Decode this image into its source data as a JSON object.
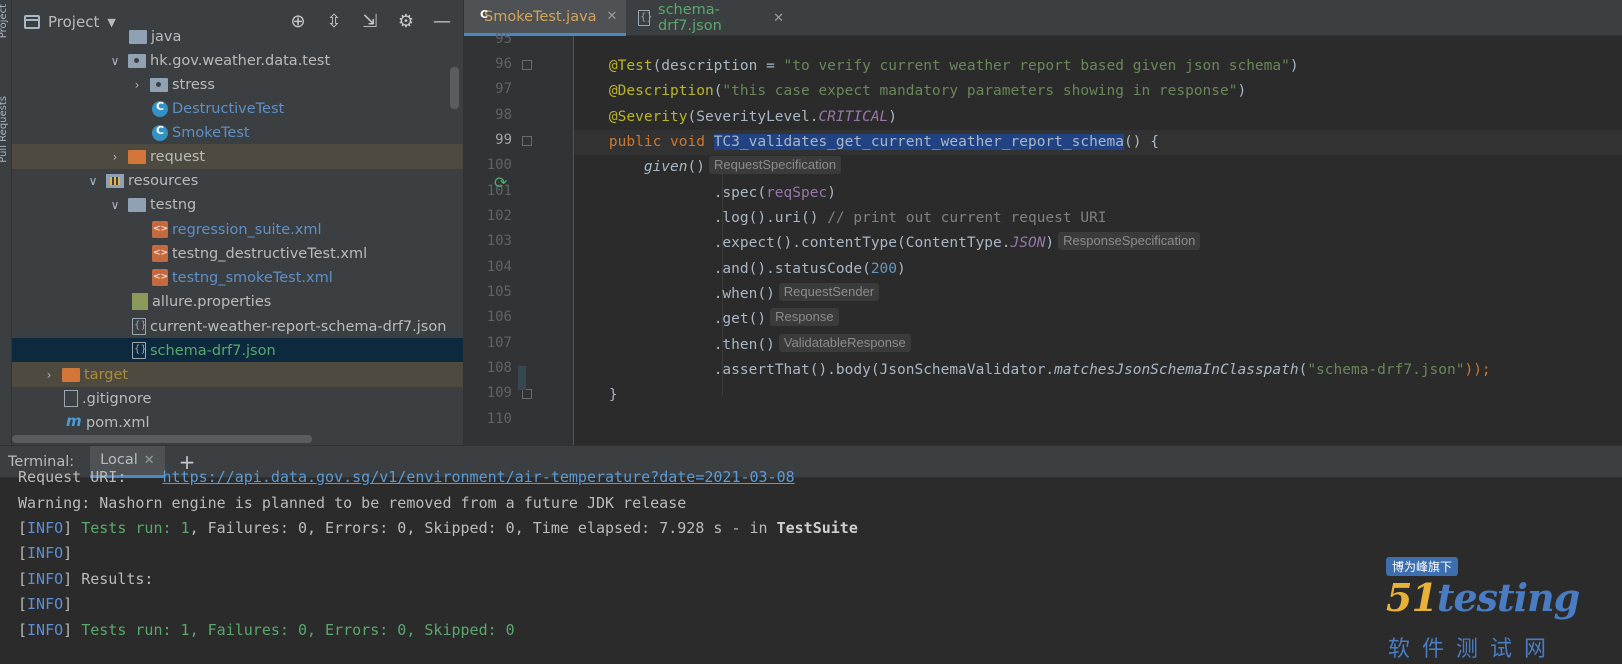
{
  "side_strip": {
    "tabs": [
      "Project",
      "Pull Requests"
    ]
  },
  "project_panel": {
    "title": "Project",
    "tree": [
      {
        "label": "java",
        "depth": 5,
        "icon": "folder-icon",
        "arrow": ""
      },
      {
        "label": "hk.gov.weather.data.test",
        "depth": 6,
        "icon": "package-folder-icon",
        "arrow": "expanded"
      },
      {
        "label": "stress",
        "depth": 7,
        "icon": "package-folder-icon",
        "arrow": "collapsed"
      },
      {
        "label": "DestructiveTest",
        "depth": 8,
        "icon": "class-icon",
        "arrow": ""
      },
      {
        "label": "SmokeTest",
        "depth": 8,
        "icon": "class-icon",
        "arrow": ""
      },
      {
        "label": "request",
        "depth": 6,
        "icon": "orange-folder-icon",
        "arrow": "collapsed"
      },
      {
        "label": "resources",
        "depth": 5,
        "icon": "resources-folder-icon",
        "arrow": "expanded"
      },
      {
        "label": "testng",
        "depth": 6,
        "icon": "folder-icon",
        "arrow": "expanded"
      },
      {
        "label": "regression_suite.xml",
        "depth": 8,
        "icon": "xml-file-icon",
        "arrow": ""
      },
      {
        "label": "testng_destructiveTest.xml",
        "depth": 8,
        "icon": "xml-file-icon",
        "arrow": ""
      },
      {
        "label": "testng_smokeTest.xml",
        "depth": 8,
        "icon": "xml-file-icon",
        "arrow": ""
      },
      {
        "label": "allure.properties",
        "depth": 7,
        "icon": "properties-file-icon",
        "arrow": ""
      },
      {
        "label": "current-weather-report-schema-drf7.json",
        "depth": 7,
        "icon": "json-file-icon",
        "arrow": ""
      },
      {
        "label": "schema-drf7.json",
        "depth": 7,
        "icon": "json-file-icon",
        "arrow": ""
      },
      {
        "label": "target",
        "depth": 2,
        "icon": "orange-folder-icon",
        "arrow": "collapsed"
      },
      {
        "label": ".gitignore",
        "depth": 3,
        "icon": "file-icon",
        "arrow": ""
      },
      {
        "label": "pom.xml",
        "depth": 3,
        "icon": "maven-icon",
        "arrow": ""
      }
    ]
  },
  "editor": {
    "tabs": [
      {
        "label": "SmokeTest.java",
        "active": true
      },
      {
        "label": "schema-drf7.json",
        "active": false
      }
    ],
    "line_numbers": [
      "95",
      "96",
      "97",
      "98",
      "99",
      "100",
      "101",
      "102",
      "103",
      "104",
      "105",
      "106",
      "107",
      "108",
      "109",
      "110"
    ],
    "lines": {
      "l95": "",
      "l96_a": "@Test",
      "l96_b": "(description = ",
      "l96_c": "\"to verify current weather report based given json schema\"",
      "l96_d": ")",
      "l97_a": "@Description",
      "l97_b": "(",
      "l97_c": "\"this case expect mandatory parameters showing in response\"",
      "l97_d": ")",
      "l98_a": "@Severity",
      "l98_b": "(SeverityLevel.",
      "l98_c": "CRITICAL",
      "l98_d": ")",
      "l99_a": "public void ",
      "l99_b": "TC3_validates_get_current_weather_report_schema",
      "l99_c": "() {",
      "l100_a": "given",
      "l100_b": "()",
      "l100_hint": "RequestSpecification",
      "l101_a": ".spec(",
      "l101_b": "reqSpec",
      "l101_c": ")",
      "l102_a": ".log().uri() ",
      "l102_b": "// print out current request URI",
      "l103_a": ".expect().contentType(ContentType.",
      "l103_b": "JSON",
      "l103_c": ")",
      "l103_hint": "ResponseSpecification",
      "l104_a": ".and().statusCode(",
      "l104_b": "200",
      "l104_c": ")",
      "l105_a": ".when()",
      "l105_hint": "RequestSender",
      "l106_a": ".get()",
      "l106_hint": "Response",
      "l107_a": ".then()",
      "l107_hint": "ValidatableResponse",
      "l108_a": ".assertThat().body(JsonSchemaValidator.",
      "l108_b": "matchesJsonSchemaInClasspath",
      "l108_c": "(",
      "l108_d": "\"schema-drf7.json\"",
      "l108_e": "));",
      "l109": "}"
    }
  },
  "terminal": {
    "label": "Terminal:",
    "tab": "Local",
    "plus": "+",
    "lines": {
      "t1_a": "Request URI:    ",
      "t1_b": "https://api.data.gov.sg/v1/environment/air-temperature?date=2021-03-08",
      "t2": "Warning: Nashorn engine is planned to be removed from a future JDK release",
      "t3_a": "[",
      "t3_b": "INFO",
      "t3_c": "] ",
      "t3_d": "Tests run: ",
      "t3_e": "1",
      "t3_f": ", Failures: 0, Errors: 0, Skipped: 0, Time elapsed: 7.928 s - in ",
      "t3_g": "TestSuite",
      "t4_b": "INFO",
      "t5_b": "INFO",
      "t5_d": "Results:",
      "t6_b": "INFO",
      "t7_b": "INFO",
      "t7_d": "Tests run: 1, Failures: 0, Errors: 0, Skipped: 0"
    }
  },
  "watermark": {
    "badge": "博为峰旗下",
    "logo_num": "51",
    "logo_word": "testing",
    "sub": "软件测试网"
  }
}
